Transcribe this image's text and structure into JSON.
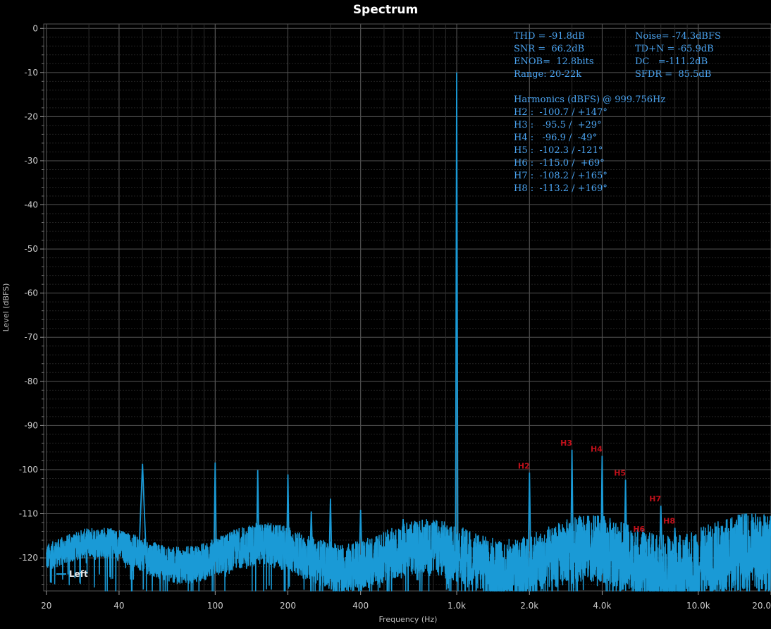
{
  "chart_data": {
    "type": "line",
    "title": "Spectrum",
    "xlabel": "Frequency (Hz)",
    "ylabel": "Level (dBFS)",
    "xscale": "log",
    "xlim": [
      19.5,
      20000
    ],
    "ylim": [
      -127.5,
      1
    ],
    "grid": true,
    "x_ticks": [
      {
        "v": 20,
        "label": "20"
      },
      {
        "v": 40,
        "label": "40"
      },
      {
        "v": 100,
        "label": "100"
      },
      {
        "v": 200,
        "label": "200"
      },
      {
        "v": 400,
        "label": "400"
      },
      {
        "v": 1000,
        "label": "1.0k"
      },
      {
        "v": 2000,
        "label": "2.0k"
      },
      {
        "v": 4000,
        "label": "4.0k"
      },
      {
        "v": 10000,
        "label": "10.0k"
      },
      {
        "v": 20000,
        "label": "20.0"
      }
    ],
    "y_ticks": [
      {
        "v": 0,
        "label": "0"
      },
      {
        "v": -10,
        "label": "-10"
      },
      {
        "v": -20,
        "label": "-20"
      },
      {
        "v": -30,
        "label": "-30"
      },
      {
        "v": -40,
        "label": "-40"
      },
      {
        "v": -50,
        "label": "-50"
      },
      {
        "v": -60,
        "label": "-60"
      },
      {
        "v": -70,
        "label": "-70"
      },
      {
        "v": -80,
        "label": "-80"
      },
      {
        "v": -90,
        "label": "-90"
      },
      {
        "v": -100,
        "label": "-100"
      },
      {
        "v": -110,
        "label": "-110"
      },
      {
        "v": -120,
        "label": "-120"
      }
    ],
    "series": [
      {
        "name": "Left",
        "color": "#1a9ad6",
        "peaks": [
          {
            "x": 50,
            "y": -98.7
          },
          {
            "x": 100,
            "y": -98.4
          },
          {
            "x": 150,
            "y": -100.1
          },
          {
            "x": 200,
            "y": -101.1
          },
          {
            "x": 250,
            "y": -109.5
          },
          {
            "x": 300,
            "y": -106.6
          },
          {
            "x": 400,
            "y": -109.1
          },
          {
            "x": 600,
            "y": -111.2
          },
          {
            "x": 999.756,
            "y": -10.0
          },
          {
            "x": 2000,
            "y": -100.7
          },
          {
            "x": 3000,
            "y": -95.5
          },
          {
            "x": 4000,
            "y": -96.9
          },
          {
            "x": 5000,
            "y": -102.3
          },
          {
            "x": 6000,
            "y": -115.0
          },
          {
            "x": 7000,
            "y": -108.2
          },
          {
            "x": 8000,
            "y": -113.2
          }
        ]
      }
    ],
    "legend": "bottom-left",
    "harmonic_markers": [
      {
        "label": "H2",
        "x": 2000,
        "y": -100.7
      },
      {
        "label": "H3",
        "x": 3000,
        "y": -95.5
      },
      {
        "label": "H4",
        "x": 4000,
        "y": -96.9
      },
      {
        "label": "H5",
        "x": 5000,
        "y": -102.3
      },
      {
        "label": "H6",
        "x": 6000,
        "y": -115.0
      },
      {
        "label": "H7",
        "x": 7000,
        "y": -108.2
      },
      {
        "label": "H8",
        "x": 8000,
        "y": -113.2
      }
    ],
    "marker_color": "#c0101a"
  },
  "stats": {
    "color": "#4aa3f0",
    "lines": [
      "THD = -91.8dB",
      "Noise= -74.3dBFS",
      "SNR =  66.2dB",
      "TD+N = -65.9dB",
      "ENOB=  12.8bits",
      "DC   =-111.2dB",
      "Range: 20-22k",
      "SFDR =  85.5dB"
    ],
    "harmonics_header": "Harmonics (dBFS) @ 999.756Hz",
    "harmonics": [
      "H2 :  -100.7 / +147°",
      "H3 :   -95.5 /  +29°",
      "H4 :   -96.9 /  -49°",
      "H5 :  -102.3 / -121°",
      "H6 :  -115.0 /  +69°",
      "H7 :  -108.2 / +165°",
      "H8 :  -113.2 / +169°"
    ]
  }
}
